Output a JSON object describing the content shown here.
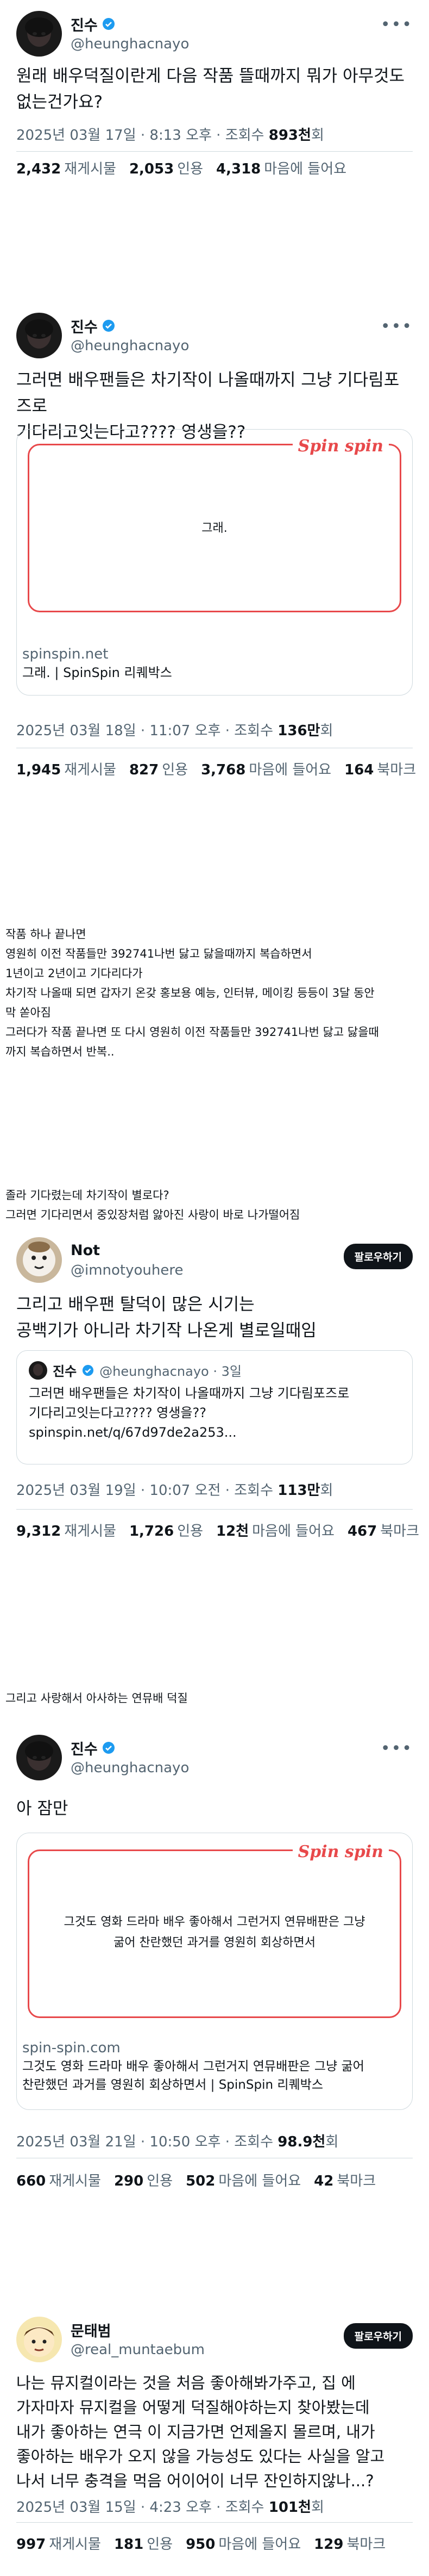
{
  "tweet1": {
    "name": "진수",
    "handle": "@heunghacnayo",
    "text": "원래 배우덕질이란게 다음 작품 뜰때까지 뭐가 아무것도\n없는건가요?",
    "datetime": "2025년 03월 17일 · 8:13 오후 · 조회수 ",
    "views": "893천",
    "views_suffix": "회",
    "stats": [
      {
        "count": "2,432",
        "label": "재게시물"
      },
      {
        "count": "2,053",
        "label": "인용"
      },
      {
        "count": "4,318",
        "label": "마음에 들어요"
      }
    ]
  },
  "tweet2": {
    "name": "진수",
    "handle": "@heunghacnayo",
    "text": "그러면 배우팬들은 차기작이 나올때까지 그냥 기다림포즈로\n기다리고잇는다고???? 영생을??",
    "card_logo": "Spin spin",
    "card_text": "그래.",
    "card_domain": "spinspin.net",
    "card_title": "그래. | SpinSpin 리퀘박스",
    "datetime": "2025년 03월 18일 · 11:07 오후 · 조회수 ",
    "views": "136만",
    "views_suffix": "회",
    "stats": [
      {
        "count": "1,945",
        "label": "재게시물"
      },
      {
        "count": "827",
        "label": "인용"
      },
      {
        "count": "3,768",
        "label": "마음에 들어요"
      },
      {
        "count": "164",
        "label": "북마크"
      }
    ]
  },
  "interlude1": "작품 하나 끝나면\n영원히 이전 작품들만 392741나번 닳고 닳을때까지 복습하면서\n1년이고 2년이고 기다리다가\n차기작 나올때 되면 갑자기 온갖 홍보용 예능, 인터뷰, 메이킹 등등이 3달 동안\n막 쏟아짐\n그러다가 작품 끝나면 또 다시 영원히 이전 작품들만 392741나번 닳고 닳을때\n까지 복습하면서 반복..",
  "interlude2": "졸라 기다렸는데 차기작이 별로다?\n그러면 기다리면서 중있장처럼 앓아진 사랑이 바로 나가떨어짐",
  "tweet3": {
    "name": "Not",
    "handle": "@imnotyouhere",
    "follow": "팔로우하기",
    "text": "그리고 배우팬 탈덕이 많은 시기는\n공백기가 아니라 차기작 나온게 별로일때임",
    "quote_name": "진수",
    "quote_handle": "@heunghacnayo · 3일",
    "quote_text": "그러면 배우팬들은 차기작이 나올때까지 그냥 기다림포즈로\n기다리고잇는다고???? 영생을??\nspinspin.net/q/67d97de2a253...",
    "datetime": "2025년 03월 19일 · 10:07 오전 · 조회수 ",
    "views": "113만",
    "views_suffix": "회",
    "stats": [
      {
        "count": "9,312",
        "label": "재게시물"
      },
      {
        "count": "1,726",
        "label": "인용"
      },
      {
        "count": "12천",
        "label": "마음에 들어요"
      },
      {
        "count": "467",
        "label": "북마크"
      }
    ]
  },
  "interlude3": "그리고 사랑해서 아사하는 연뮤배 덕질",
  "tweet4": {
    "name": "진수",
    "handle": "@heunghacnayo",
    "text": "아 잠만",
    "card_logo": "Spin spin",
    "card_text": "그것도 영화 드라마 배우 좋아해서 그런거지 연뮤배판은 그냥\n굶어 찬란했던 과거를 영원히 회상하면서",
    "card_domain": "spin-spin.com",
    "card_title": "그것도 영화 드라마 배우 좋아해서 그런거지 연뮤배판은 그냥 굶어\n찬란했던 과거를 영원히 회상하면서 | SpinSpin 리퀘박스",
    "datetime": "2025년 03월 21일 · 10:50 오후 · 조회수 ",
    "views": "98.9천",
    "views_suffix": "회",
    "stats": [
      {
        "count": "660",
        "label": "재게시물"
      },
      {
        "count": "290",
        "label": "인용"
      },
      {
        "count": "502",
        "label": "마음에 들어요"
      },
      {
        "count": "42",
        "label": "북마크"
      }
    ]
  },
  "tweet5": {
    "name": "문태범",
    "handle": "@real_muntaebum",
    "follow": "팔로우하기",
    "text": "나는 뮤지컬이라는 것을 처음 좋아해봐가주고, 집 에\n가자마자 뮤지컬을 어떻게 덕질해야하는지 찾아봤는데\n내가 좋아하는 연극 이 지금가면 언제올지 몰르며, 내가\n좋아하는 배우가 오지 않을 가능성도 있다는 사실을 알고\n나서 너무 충격을 먹음 어이어이 너무 잔인하지않나...?",
    "datetime": "2025년 03월 15일 · 4:23 오후 · 조회수 ",
    "views": "101천",
    "views_suffix": "회",
    "stats": [
      {
        "count": "997",
        "label": "재게시물"
      },
      {
        "count": "181",
        "label": "인용"
      },
      {
        "count": "950",
        "label": "마음에 들어요"
      },
      {
        "count": "129",
        "label": "북마크"
      }
    ]
  },
  "colors": {
    "accent": "#1d9bf0",
    "spin": "#e8494b",
    "muted": "#536471"
  },
  "icons": {
    "verified": "verified-badge-icon",
    "more": "more-icon"
  }
}
